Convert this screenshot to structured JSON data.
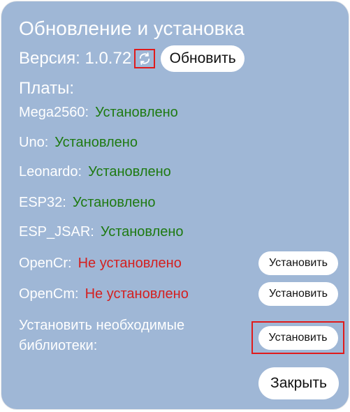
{
  "dialog": {
    "title": "Обновление и установка",
    "version_label": "Версия: 1.0.72",
    "refresh_icon": "refresh-icon",
    "update_button": "Обновить",
    "boards_title": "Платы:",
    "boards": [
      {
        "name": "Mega2560:",
        "status": "Установлено",
        "installed": true
      },
      {
        "name": "Uno:",
        "status": "Установлено",
        "installed": true
      },
      {
        "name": "Leonardo:",
        "status": "Установлено",
        "installed": true
      },
      {
        "name": "ESP32:",
        "status": "Установлено",
        "installed": true
      },
      {
        "name": "ESP_JSAR:",
        "status": "Установлено",
        "installed": true
      },
      {
        "name": "OpenCr:",
        "status": "Не установлено",
        "installed": false,
        "button": "Установить"
      },
      {
        "name": "OpenCm:",
        "status": "Не установлено",
        "installed": false,
        "button": "Установить"
      }
    ],
    "libraries_text": "Установить необходимые библиотеки:",
    "libraries_button": "Установить",
    "close_button": "Закрыть"
  },
  "colors": {
    "background": "#9fb7d6",
    "installed": "#1e7a12",
    "not_installed": "#d42020",
    "highlight": "#e01b1b"
  }
}
